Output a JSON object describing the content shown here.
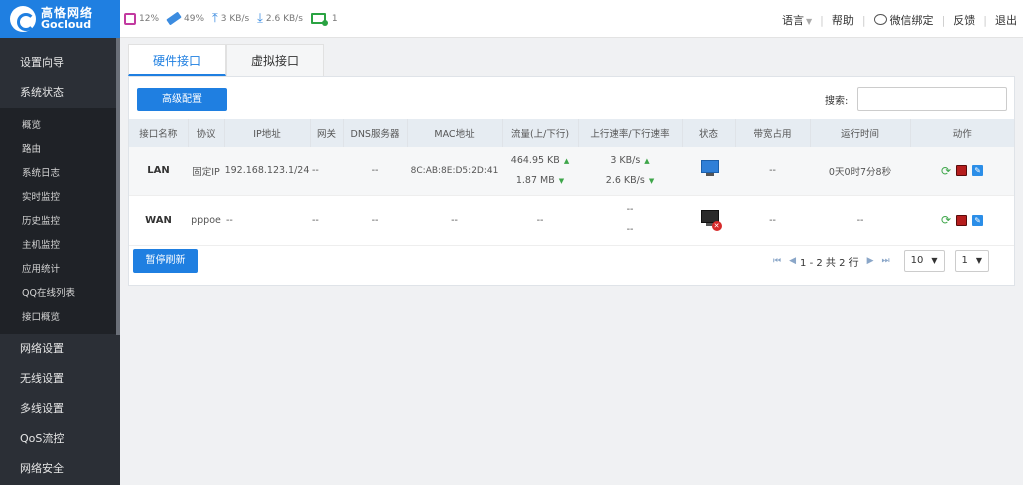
{
  "brand": {
    "name_cn": "高恪网络",
    "name_en": "Gocloud"
  },
  "stats": {
    "cpu": "12%",
    "mem": "49%",
    "upload": "3 KB/s",
    "download": "2.6 KB/s",
    "online": "1"
  },
  "topnav": {
    "language": "语言",
    "help": "帮助",
    "wechat": "微信绑定",
    "feedback": "反馈",
    "logout": "退出"
  },
  "sidebar": {
    "top_items": [
      "设置向导",
      "系统状态"
    ],
    "sub_items": [
      "概览",
      "路由",
      "系统日志",
      "实时监控",
      "历史监控",
      "主机监控",
      "应用统计",
      "QQ在线列表",
      "接口概览"
    ],
    "bottom_items": [
      "网络设置",
      "无线设置",
      "多线设置",
      "QoS流控",
      "网络安全"
    ]
  },
  "tabs": [
    "硬件接口",
    "虚拟接口"
  ],
  "toolbar": {
    "advanced": "高级配置",
    "search_label": "搜索:",
    "search_value": ""
  },
  "table": {
    "headers": [
      "接口名称",
      "协议",
      "IP地址",
      "网关",
      "DNS服务器",
      "MAC地址",
      "流量(上/下行)",
      "上行速率/下行速率",
      "状态",
      "带宽占用",
      "运行时间",
      "动作"
    ],
    "rows": [
      {
        "name": "LAN",
        "protocol": "固定IP",
        "ip": "192.168.123.1/24",
        "gateway": "--",
        "dns": "--",
        "mac": "8C:AB:8E:D5:2D:41",
        "traffic_up": "464.95 KB",
        "traffic_down": "1.87 MB",
        "rate_up": "3 KB/s",
        "rate_down": "2.6 KB/s",
        "status": "connected",
        "bandwidth": "--",
        "uptime": "0天0时7分8秒"
      },
      {
        "name": "WAN",
        "protocol": "pppoe",
        "ip": "--",
        "gateway": "--",
        "dns": "--",
        "mac": "--",
        "traffic_up": "--",
        "traffic_down": "",
        "rate_up": "--",
        "rate_down": "--",
        "status": "disconnected",
        "bandwidth": "--",
        "uptime": "--"
      }
    ]
  },
  "footer": {
    "pause": "暂停刷新",
    "pager_text": "1 - 2 共 2 行",
    "page_size": "10",
    "page": "1"
  },
  "colors": {
    "accent": "#1f7fe1",
    "sidebar": "#2b2f36",
    "ok": "#3ea64a",
    "error": "#d62b2b"
  }
}
